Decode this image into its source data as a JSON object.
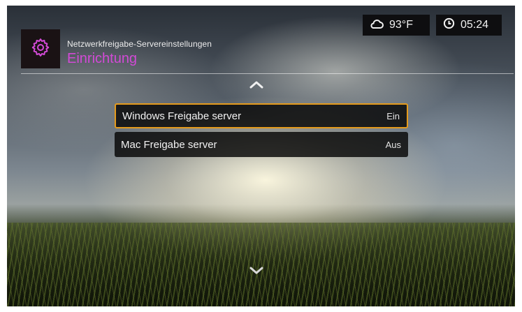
{
  "header": {
    "subtitle": "Netzwerkfreigabe-Servereinstellungen",
    "title": "Einrichtung",
    "settings_icon": "gear-icon",
    "title_color": "#d24ad6"
  },
  "status": {
    "weather_icon": "cloud-icon",
    "temperature": "93°F",
    "clock_icon": "clock-icon",
    "time": "05:24"
  },
  "options": [
    {
      "label": "Windows Freigabe server",
      "value": "Ein",
      "selected": true
    },
    {
      "label": "Mac Freigabe server",
      "value": "Aus",
      "selected": false
    }
  ],
  "navigation": {
    "up_icon": "chevron-up-icon",
    "down_icon": "chevron-down-icon"
  },
  "accent_color": "#e59b1d"
}
